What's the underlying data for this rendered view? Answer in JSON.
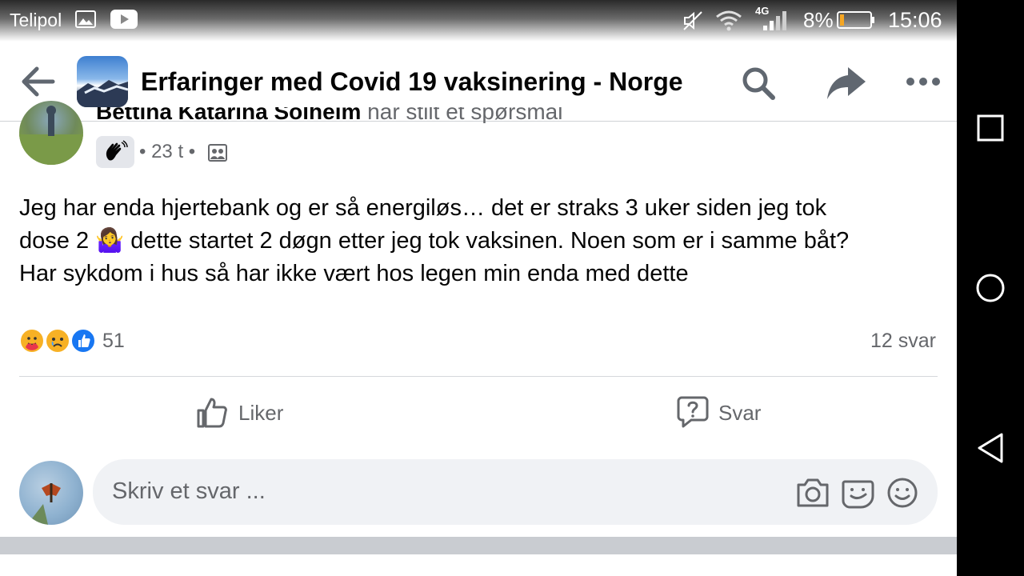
{
  "status_bar": {
    "carrier": "Telipol",
    "network": "4G",
    "battery": "8%",
    "time": "15:06"
  },
  "header": {
    "title": "Erfaringer med Covid 19 vaksinering - Norge",
    "icons": [
      "back-arrow-icon",
      "search-icon",
      "share-icon",
      "more-icon"
    ]
  },
  "post": {
    "author": "Bettina Katarina Solheim",
    "action": " har stilt et spørsmål",
    "time": "23 t",
    "text_lines": [
      "Jeg har enda hjertebank og er så energiløs… det er straks 3 uker siden jeg tok",
      "dose 2 🤷‍♀️ dette startet 2 døgn etter jeg tok vaksinen. Noen som er i samme båt?",
      "Har sykdom i hus så har ikke vært hos legen min enda med dette"
    ],
    "reaction_count": "51",
    "reply_count": "12 svar",
    "actions": {
      "like": "Liker",
      "reply": "Svar"
    }
  },
  "composer": {
    "placeholder": "Skriv et svar ..."
  },
  "colors": {
    "text": "#050505",
    "secondary_text": "#65676b",
    "like_blue": "#1877f2",
    "input_bg": "#f0f2f5"
  }
}
